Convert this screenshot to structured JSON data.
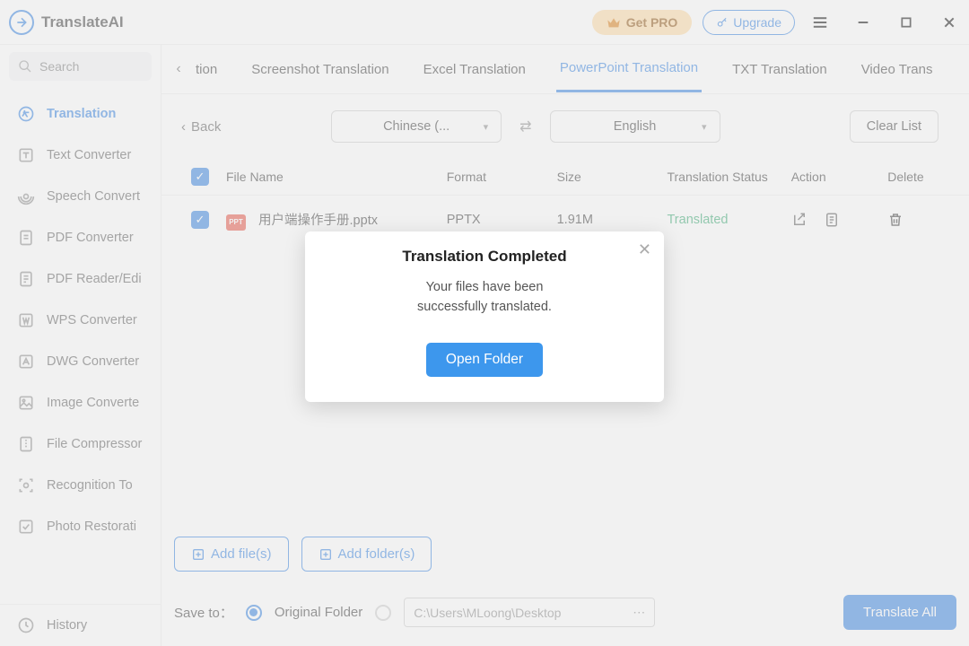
{
  "app": {
    "title": "TranslateAI"
  },
  "titlebar": {
    "getpro_label": "Get PRO",
    "upgrade_label": "Upgrade"
  },
  "search": {
    "placeholder": "Search"
  },
  "sidebar": {
    "items": [
      {
        "label": "Translation"
      },
      {
        "label": "Text Converter"
      },
      {
        "label": "Speech Convert"
      },
      {
        "label": "PDF Converter"
      },
      {
        "label": "PDF Reader/Edi"
      },
      {
        "label": "WPS Converter"
      },
      {
        "label": "DWG Converter"
      },
      {
        "label": "Image Converte"
      },
      {
        "label": "File Compressor"
      },
      {
        "label": "Recognition To"
      },
      {
        "label": "Photo Restorati"
      }
    ],
    "history_label": "History"
  },
  "tabs": {
    "partial_left": "tion",
    "items": [
      "Screenshot Translation",
      "Excel Translation",
      "PowerPoint Translation",
      "TXT Translation",
      "Video Trans"
    ],
    "active_index": 2
  },
  "controls": {
    "back_label": "Back",
    "source_lang": "Chinese (...",
    "target_lang": "English",
    "clear_label": "Clear List"
  },
  "table": {
    "headers": {
      "name": "File Name",
      "format": "Format",
      "size": "Size",
      "status": "Translation Status",
      "action": "Action",
      "delete": "Delete"
    },
    "rows": [
      {
        "name": "用户端操作手册.pptx",
        "format": "PPTX",
        "size": "1.91M",
        "status": "Translated"
      }
    ]
  },
  "bottom": {
    "add_files_label": "Add file(s)",
    "add_folder_label": "Add folder(s)",
    "save_to_label": "Save to：",
    "original_folder_label": "Original Folder",
    "custom_path": "C:\\Users\\MLoong\\Desktop",
    "translate_all_label": "Translate All"
  },
  "modal": {
    "title": "Translation Completed",
    "text_line1": "Your files have been",
    "text_line2": "successfully translated.",
    "button_label": "Open Folder"
  }
}
